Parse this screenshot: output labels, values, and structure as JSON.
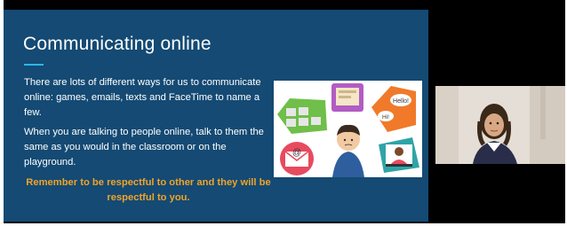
{
  "slide": {
    "title": "Communicating online",
    "paragraph1": "There are lots of different ways for us to communicate online: games, emails, texts and FaceTime to name a few.",
    "paragraph2": "When you are talking to people online, talk to them the same as you would in the classroom or on the playground.",
    "reminder": "Remember to be respectful to other and they will be respectful to you.",
    "accent_color": "#f0a32a",
    "background_color": "#144a73"
  },
  "illustration": {
    "bubble_hello": "Hello!",
    "bubble_hi": "Hi!",
    "email_symbol": "@",
    "icons": [
      "games-grid-icon",
      "tablet-icon",
      "chat-bubbles-icon",
      "email-icon",
      "video-call-icon",
      "thinking-boy-icon"
    ]
  },
  "participant_video": {
    "icon": "participant-camera-feed"
  }
}
